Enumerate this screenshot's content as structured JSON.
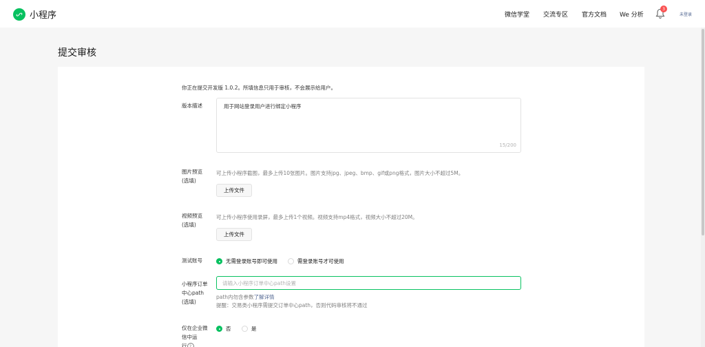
{
  "header": {
    "logo_text": "小程序",
    "nav": [
      "微信学堂",
      "交流专区",
      "官方文档",
      "We 分析"
    ],
    "notification_count": "3",
    "user_name": "未登录"
  },
  "page": {
    "title": "提交审核"
  },
  "form": {
    "intro": "你正在提交开发版 1.0.2。所填信息只用于审核，不会展示给用户。",
    "version_desc": {
      "label": "版本描述",
      "value": "用于网站登录用户进行绑定小程序",
      "count": "15/200"
    },
    "image_preview": {
      "label_line1": "图片预览",
      "label_line2": "(选填)",
      "hint": "可上传小程序截图，最多上传10张图片。图片支持jpg、jpeg、bmp、gif或png格式，图片大小不超过5M。",
      "button": "上传文件"
    },
    "video_preview": {
      "label_line1": "视频预览",
      "label_line2": "(选填)",
      "hint": "可上传小程序使用录屏，最多上传1个视频。视频支持mp4格式，视频大小不超过20M。",
      "button": "上传文件"
    },
    "test_account": {
      "label": "测试账号",
      "options": [
        "无需登录账号即可使用",
        "需登录账号才可使用"
      ],
      "selected": 0
    },
    "order_path": {
      "label_line1": "小程序订单",
      "label_line2": "中心path",
      "label_line3": "(选填)",
      "placeholder": "请输入小程序订单中心path设置",
      "note_prefix": "path内勿含参数",
      "note_link": "了解详情",
      "warning": "提醒：交易类小程序需提交订单中心path，否则代码审核将不通过"
    },
    "enterprise_wechat": {
      "label_line1": "仅在企业微",
      "label_line2": "信中运",
      "label_line3": "行",
      "options": [
        "否",
        "是"
      ],
      "selected": 0
    }
  },
  "colors": {
    "brand": "#07c160",
    "link": "#576b95",
    "badge": "#fa5151"
  }
}
